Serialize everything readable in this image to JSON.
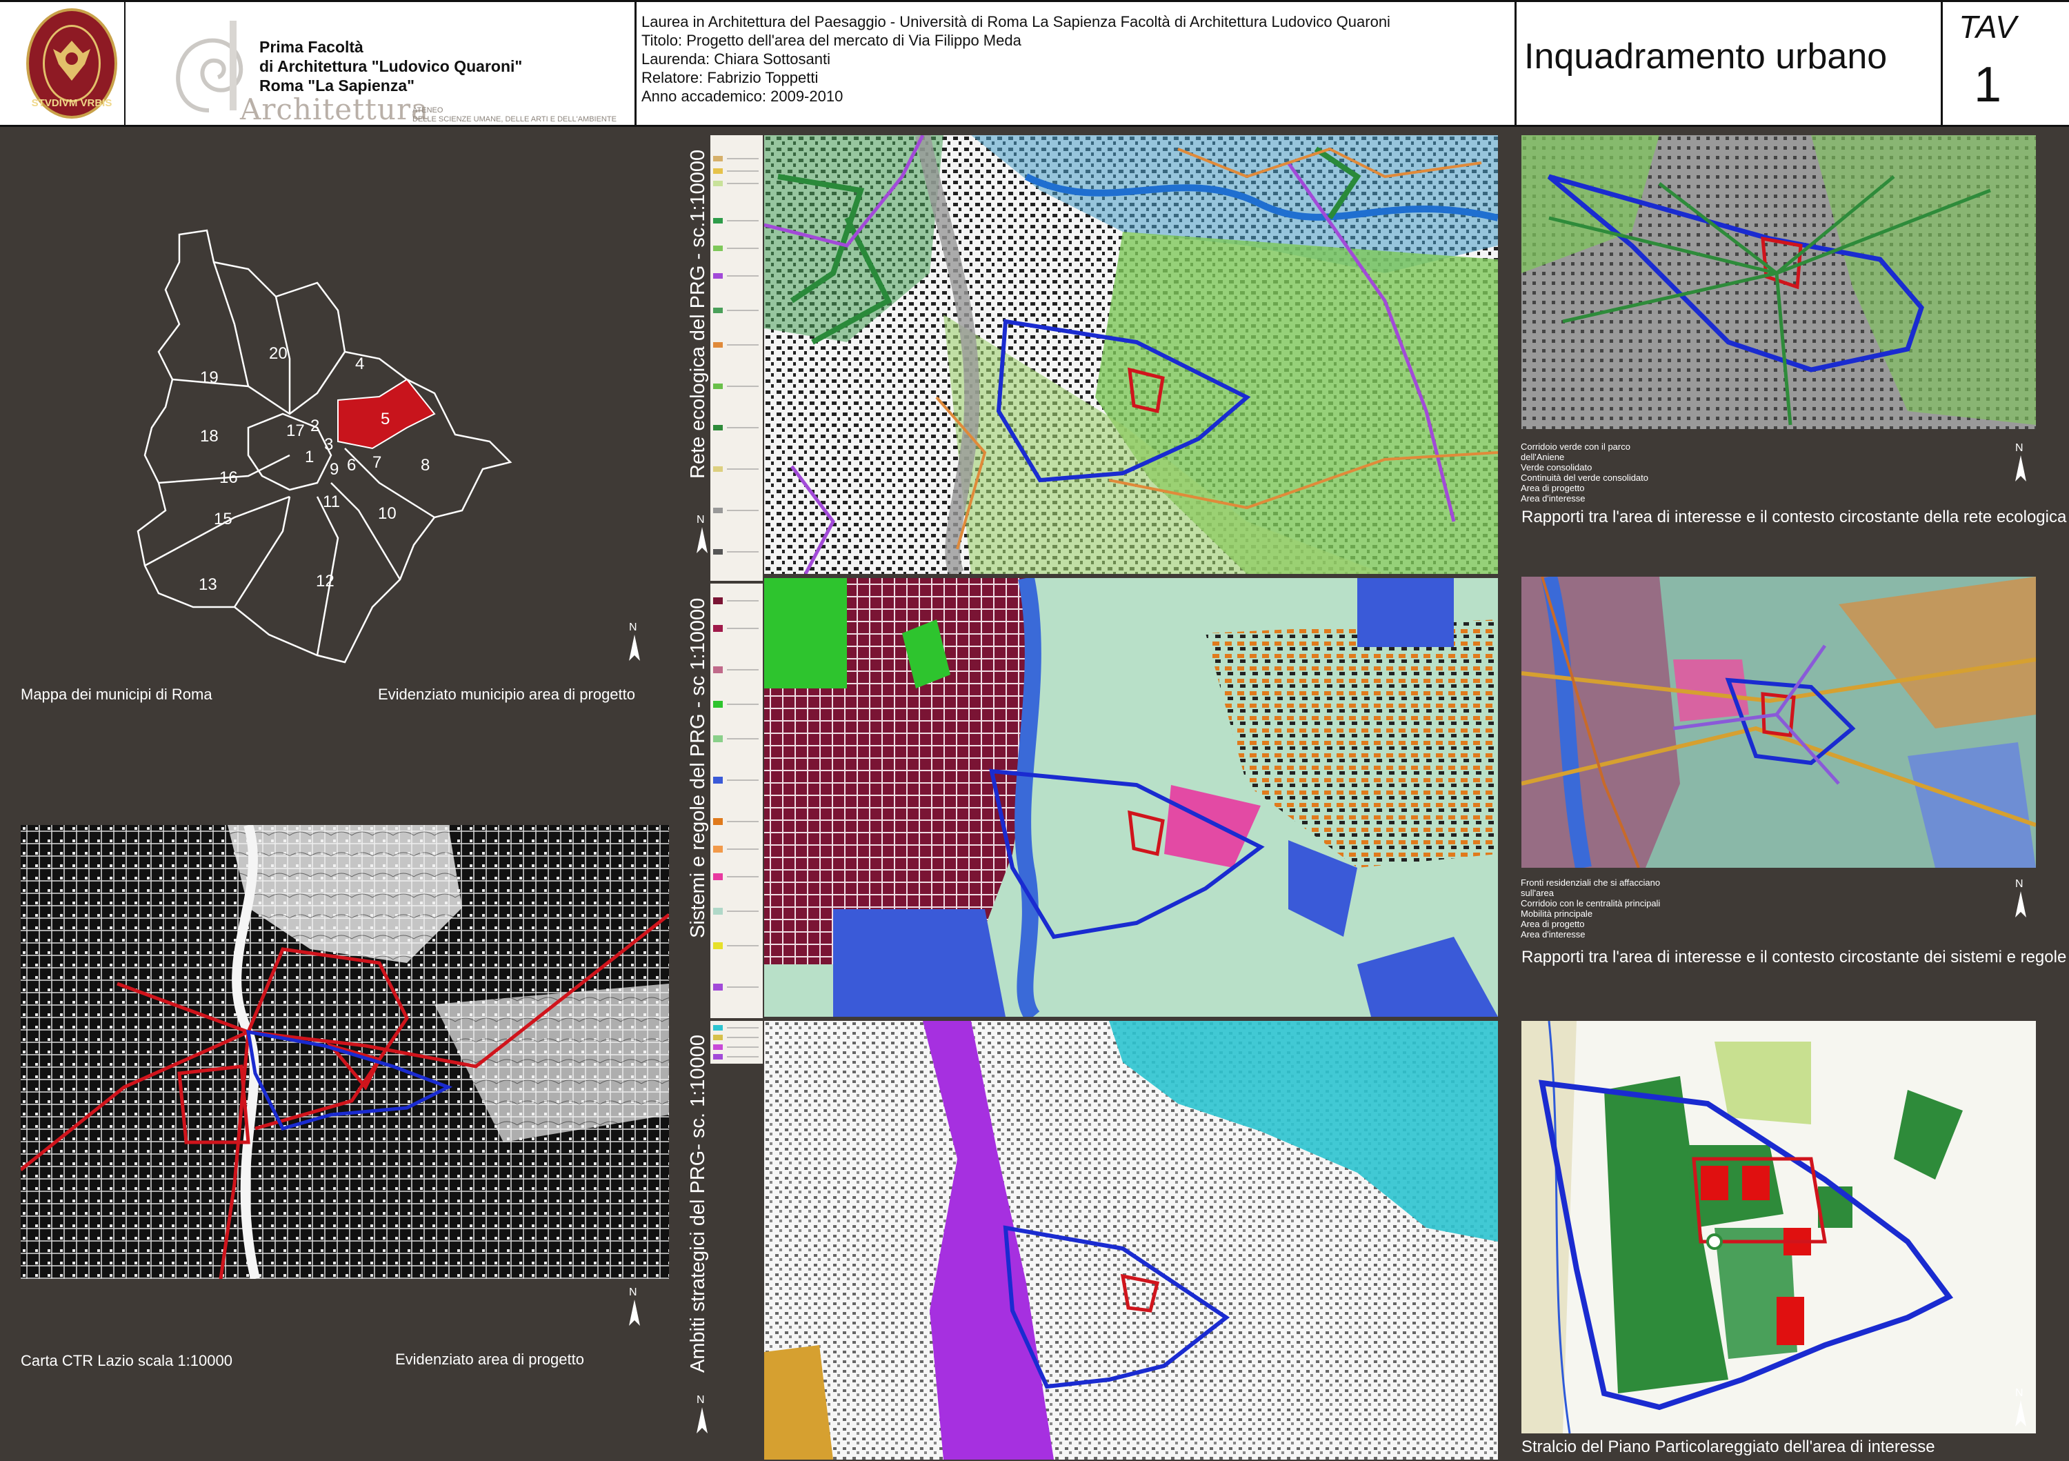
{
  "header": {
    "university_seal_motto": "STVDIVM VRBIS",
    "faculty_logo_text": "Prima Facoltà di Architettura \"Ludovico Quaroni\" Roma \"La Sapienza\"",
    "faculty_lines": [
      "Prima Facoltà",
      "di Architettura \"Ludovico Quaroni\"",
      "Roma \"La Sapienza\""
    ],
    "architettura_logo": "Architettura",
    "architettura_sub": [
      "ATENEO",
      "DELLE SCIENZE UMANE, DELLE ARTI E DELL'AMBIENTE"
    ],
    "info_lines": [
      "Laurea in Architettura del Paesaggio - Università di Roma La Sapienza Facoltà di Architettura Ludovico Quaroni",
      "Titolo: Progetto dell'area del mercato di Via Filippo Meda",
      "Laurenda: Chiara Sottosanti",
      "Relatore: Fabrizio Toppetti",
      "Anno accademico: 2009-2010"
    ],
    "sheet_title": "Inquadramento urbano",
    "tav_label": "TAV",
    "tav_number": "1"
  },
  "left": {
    "municipi_map": {
      "numbers": [
        "20",
        "4",
        "19",
        "5",
        "18",
        "17",
        "2",
        "3",
        "1",
        "16",
        "9",
        "6",
        "7",
        "8",
        "15",
        "11",
        "10",
        "13",
        "12"
      ],
      "highlight_color": "#c8141c",
      "north_label": "N",
      "caption_left": "Mappa dei municipi di Roma",
      "caption_right": "Evidenziato municipio area di progetto"
    },
    "ctr_map": {
      "north_label": "N",
      "caption_left": "Carta CTR Lazio scala 1:10000",
      "caption_right": "Evidenziato area di progetto"
    }
  },
  "middle": {
    "labels": [
      "Rete ecologica del PRG - sc.1:10000",
      "Sistemi e regole del PRG - sc 1:10000",
      "Ambiti strategici del PRG- sc. 1:10000"
    ],
    "north_label": "N"
  },
  "right": {
    "panels": [
      {
        "caption": "Rapporti tra l'area di interesse e il contesto circostante della rete ecologica",
        "legend": [
          "Corridoio verde con il parco dell'Aniene",
          "Verde consolidato",
          "Continuità del verde consolidato",
          "Area di progetto",
          "Area d'interesse"
        ]
      },
      {
        "caption": "Rapporti tra l'area di interesse e il contesto circostante dei sistemi e regole",
        "legend": [
          "Fronti residenziali che si affacciano sull'area",
          "Corridoio con le centralità principali",
          "Mobilità principale",
          "Area di progetto",
          "Area d'interesse"
        ]
      },
      {
        "caption": "Stralcio del Piano Particolareggiato dell'area di interesse",
        "legend": []
      }
    ],
    "north_label": "N"
  },
  "colors": {
    "background": "#3f3a36",
    "project_red": "#d0141c",
    "interest_blue": "#1a2bd0",
    "eco_green": "#2e8b3a",
    "orange": "#e07a1c",
    "purple": "#a24ad8",
    "crimson": "#7a1434",
    "cyan": "#2ec4d0"
  }
}
